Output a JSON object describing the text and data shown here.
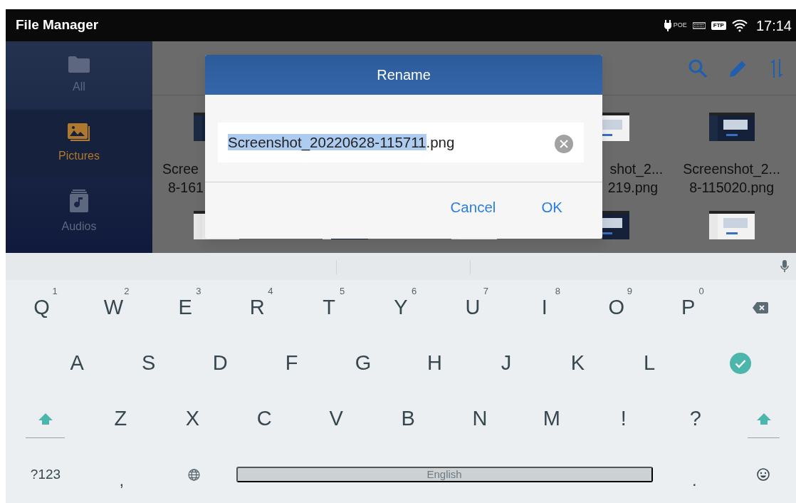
{
  "status_bar": {
    "app_title": "File Manager",
    "poe_label": "POE",
    "ftp_label": "FTP",
    "time": "17:14"
  },
  "sidebar": {
    "items": [
      {
        "label": "All",
        "kind": "folder",
        "selected": false
      },
      {
        "label": "Pictures",
        "kind": "pictures",
        "selected": true
      },
      {
        "label": "Audios",
        "kind": "audio",
        "selected": false
      }
    ]
  },
  "files": [
    {
      "kind": "cut_right",
      "name_line_1": "Scree",
      "name_line_2": "8-161"
    },
    {
      "kind": "cut_left",
      "name_line_1": "shot_2...",
      "name_line_2": "219.png"
    },
    {
      "kind": "whole",
      "name_line_1": "Screenshot_2...",
      "name_line_2": "8-115020.png"
    }
  ],
  "dialog": {
    "title": "Rename",
    "field": {
      "selected_text": "Screenshot_20220628-115711",
      "unselected_text": ".png"
    },
    "buttons": [
      "Cancel",
      "OK"
    ]
  },
  "keyboard": {
    "rows": [
      {
        "indented": false,
        "keys": [
          {
            "kind": "letter",
            "label": "Q",
            "hint": "1"
          },
          {
            "kind": "letter",
            "label": "W",
            "hint": "2"
          },
          {
            "kind": "letter",
            "label": "E",
            "hint": "3"
          },
          {
            "kind": "letter",
            "label": "R",
            "hint": "4"
          },
          {
            "kind": "letter",
            "label": "T",
            "hint": "5"
          },
          {
            "kind": "letter",
            "label": "Y",
            "hint": "6"
          },
          {
            "kind": "letter",
            "label": "U",
            "hint": "7"
          },
          {
            "kind": "letter",
            "label": "I",
            "hint": "8"
          },
          {
            "kind": "letter",
            "label": "O",
            "hint": "9"
          },
          {
            "kind": "letter",
            "label": "P",
            "hint": "0"
          },
          {
            "kind": "backspace"
          }
        ]
      },
      {
        "indented": true,
        "keys": [
          {
            "kind": "letter",
            "label": "A"
          },
          {
            "kind": "letter",
            "label": "S"
          },
          {
            "kind": "letter",
            "label": "D"
          },
          {
            "kind": "letter",
            "label": "F"
          },
          {
            "kind": "letter",
            "label": "G"
          },
          {
            "kind": "letter",
            "label": "H"
          },
          {
            "kind": "letter",
            "label": "J"
          },
          {
            "kind": "letter",
            "label": "K"
          },
          {
            "kind": "letter",
            "label": "L"
          },
          {
            "kind": "enter"
          }
        ]
      },
      {
        "indented": false,
        "keys": [
          {
            "kind": "shift"
          },
          {
            "kind": "letter",
            "label": "Z"
          },
          {
            "kind": "letter",
            "label": "X"
          },
          {
            "kind": "letter",
            "label": "C"
          },
          {
            "kind": "letter",
            "label": "V"
          },
          {
            "kind": "letter",
            "label": "B"
          },
          {
            "kind": "letter",
            "label": "N"
          },
          {
            "kind": "letter",
            "label": "M"
          },
          {
            "kind": "letter",
            "label": "!"
          },
          {
            "kind": "letter",
            "label": "?"
          },
          {
            "kind": "shift"
          }
        ]
      },
      {
        "indented": false,
        "keys": [
          {
            "kind": "symbols",
            "label": "?123"
          },
          {
            "kind": "letter",
            "label": ","
          },
          {
            "kind": "globe"
          },
          {
            "kind": "space",
            "label": "English"
          },
          {
            "kind": "letter",
            "label": "."
          },
          {
            "kind": "emoji"
          }
        ]
      }
    ]
  }
}
